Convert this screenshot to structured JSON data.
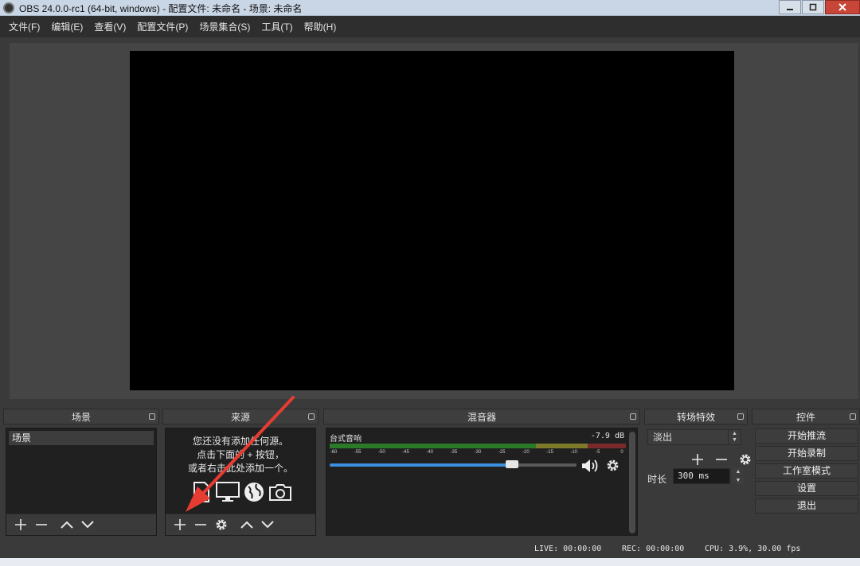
{
  "window": {
    "title": "OBS 24.0.0-rc1 (64-bit, windows) - 配置文件: 未命名 - 场景: 未命名"
  },
  "menu": [
    "文件(F)",
    "编辑(E)",
    "查看(V)",
    "配置文件(P)",
    "场景集合(S)",
    "工具(T)",
    "帮助(H)"
  ],
  "docks": {
    "scenes": {
      "title": "场景",
      "items": [
        "场景"
      ]
    },
    "sources": {
      "title": "来源",
      "empty_lines": [
        "您还没有添加任何源。",
        "点击下面的 + 按钮，",
        "或者右击此处添加一个。"
      ]
    },
    "mixer": {
      "title": "混音器",
      "track": {
        "name": "台式音响",
        "level": "-7.9 dB",
        "ticks": [
          "-60",
          "-55",
          "-50",
          "-45",
          "-40",
          "-35",
          "-30",
          "-25",
          "-20",
          "-15",
          "-10",
          "-5",
          "0"
        ],
        "volume_fraction": 0.74
      }
    },
    "transitions": {
      "title": "转场特效",
      "selected": "淡出",
      "duration_label": "时长",
      "duration_value": "300 ms"
    },
    "controls": {
      "title": "控件",
      "buttons": [
        "开始推流",
        "开始录制",
        "工作室模式",
        "设置",
        "退出"
      ]
    }
  },
  "status": {
    "live": "LIVE: 00:00:00",
    "rec": "REC: 00:00:00",
    "cpu": "CPU: 3.9%, 30.00 fps"
  },
  "colors": {
    "accent": "#3b8fe0",
    "annotation_arrow": "#e63c32"
  }
}
